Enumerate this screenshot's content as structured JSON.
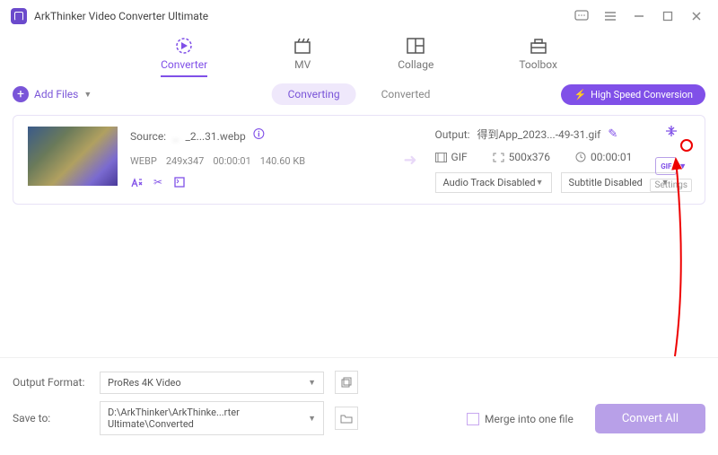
{
  "app_title": "ArkThinker Video Converter Ultimate",
  "tabs": {
    "converter": "Converter",
    "mv": "MV",
    "collage": "Collage",
    "toolbox": "Toolbox"
  },
  "toolbar": {
    "add_files": "Add Files",
    "converting": "Converting",
    "converted": "Converted",
    "high_speed": "High Speed Conversion"
  },
  "item": {
    "source_label": "Source:",
    "source_blur": "_",
    "source_file": "_2...31.webp",
    "format": "WEBP",
    "dims": "249x347",
    "dur": "00:00:01",
    "size": "140.60 KB",
    "output_label": "Output:",
    "output_file": "得到App_2023...-49-31.gif",
    "out_fmt": "GIF",
    "out_dims": "500x376",
    "out_dur": "00:00:01",
    "audio": "Audio Track Disabled",
    "subtitle": "Subtitle Disabled",
    "fmt_btn": "GIF",
    "settings": "Settings"
  },
  "footer": {
    "output_format_label": "Output Format:",
    "output_format": "ProRes 4K Video",
    "save_to_label": "Save to:",
    "save_to": "D:\\ArkThinker\\ArkThinke...rter Ultimate\\Converted",
    "merge": "Merge into one file",
    "convert": "Convert All"
  }
}
